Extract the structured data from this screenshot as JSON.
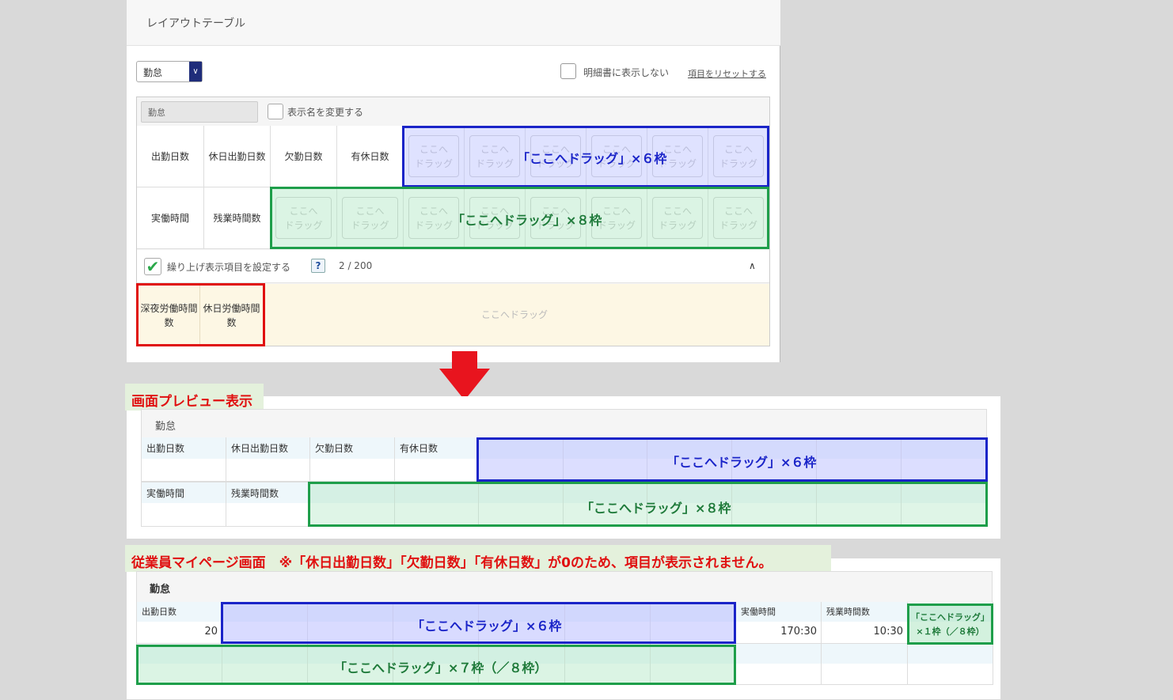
{
  "editor": {
    "title": "レイアウトテーブル",
    "category_select": "勤怠",
    "hide_checkbox_label": "明細書に表示しない",
    "reset_link": "項目をリセットする",
    "display_name_value": "勤怠",
    "rename_checkbox_label": "表示名を変更する",
    "row1": [
      "出勤日数",
      "休日出勤日数",
      "欠勤日数",
      "有休日数"
    ],
    "row2": [
      "実働時間",
      "残業時間数"
    ],
    "drop_placeholder": "ここへ\nドラッグ",
    "round_checkbox_label": "繰り上げ表示項目を設定する",
    "help_icon_label": "?",
    "round_count": "2 / 200",
    "round_items": [
      "深夜労働時間数",
      "休日労働時間数"
    ],
    "round_drop_text": "ここへドラッグ"
  },
  "annotations": {
    "blue_six": "「ここへドラッグ」×６枠",
    "green_eight": "「ここへドラッグ」×８枠",
    "green_seven": "「ここへドラッグ」×７枠（／８枠）",
    "green_one": "「ここへドラッグ」×１枠（／８枠）"
  },
  "preview": {
    "label": "画面プレビュー表示",
    "section_title": "勤怠",
    "row1": [
      "出勤日数",
      "休日出勤日数",
      "欠勤日数",
      "有休日数"
    ],
    "row2": [
      "実働時間",
      "残業時間数"
    ]
  },
  "employee": {
    "label": "従業員マイページ画面　※「休日出勤日数」「欠勤日数」「有休日数」が0のため、項目が表示されません。",
    "section_title": "勤怠",
    "items": [
      {
        "label": "出勤日数",
        "value": "20"
      },
      {
        "label": "実働時間",
        "value": "170:30"
      },
      {
        "label": "残業時間数",
        "value": "10:30"
      }
    ]
  },
  "colors": {
    "blue_frame": "#1a24c8",
    "green_frame": "#1e9e4a",
    "red_frame": "#e01010",
    "arrow": "#e8141e"
  }
}
